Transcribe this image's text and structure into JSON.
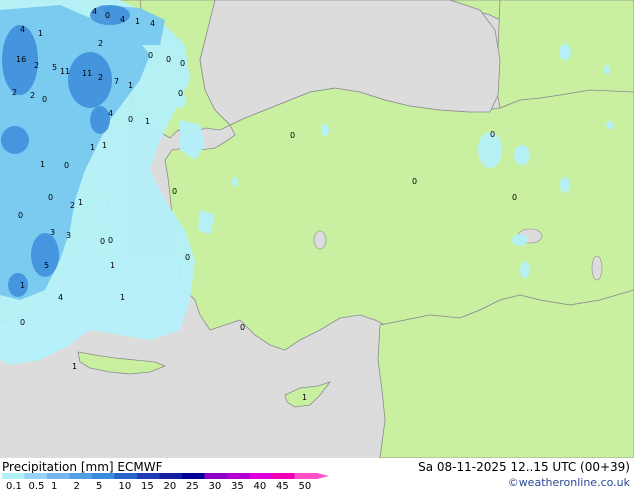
{
  "legend": {
    "title": "Precipitation [mm]",
    "model": "ECMWF",
    "datetime": "Sa 08-11-2025 12..15 UTC (00+39)",
    "credit": "©weatheronline.co.uk",
    "scale_values": [
      "0.1",
      "0.5",
      "1",
      "2",
      "5",
      "10",
      "15",
      "20",
      "25",
      "30",
      "35",
      "40",
      "45",
      "50"
    ],
    "scale_colors": [
      "#b4f0fa",
      "#96d2fa",
      "#78b4f0",
      "#50a0e6",
      "#3c8cdc",
      "#2864c8",
      "#1e3cb4",
      "#141ea0",
      "#000096",
      "#8c00c8",
      "#b400d2",
      "#dc00dc",
      "#f000b4",
      "#ff50c8"
    ]
  },
  "map": {
    "colors": {
      "sea": "#dcdcdc",
      "land": "#c8f0a0",
      "coast": "#8c8c8c",
      "rain_light": "#b4f0fa",
      "rain_mid": "#78c8f0",
      "rain_heavy": "#3c8cdc"
    },
    "labels": [
      "4",
      "4",
      "1",
      "0",
      "4",
      "4",
      "1",
      "16",
      "2",
      "5",
      "1",
      "11",
      "2",
      "2",
      "7",
      "2",
      "4",
      "1",
      "0",
      "2",
      "5",
      "3",
      "4",
      "1",
      "2",
      "3",
      "1",
      "1",
      "1",
      "1",
      "0",
      "0",
      "1",
      "0",
      "0",
      "0",
      "1",
      "0",
      "1",
      "0",
      "1",
      "0",
      "0",
      "0",
      "0",
      "0",
      "0",
      "1",
      "1",
      "0",
      "0",
      "0",
      "0",
      "0"
    ]
  }
}
